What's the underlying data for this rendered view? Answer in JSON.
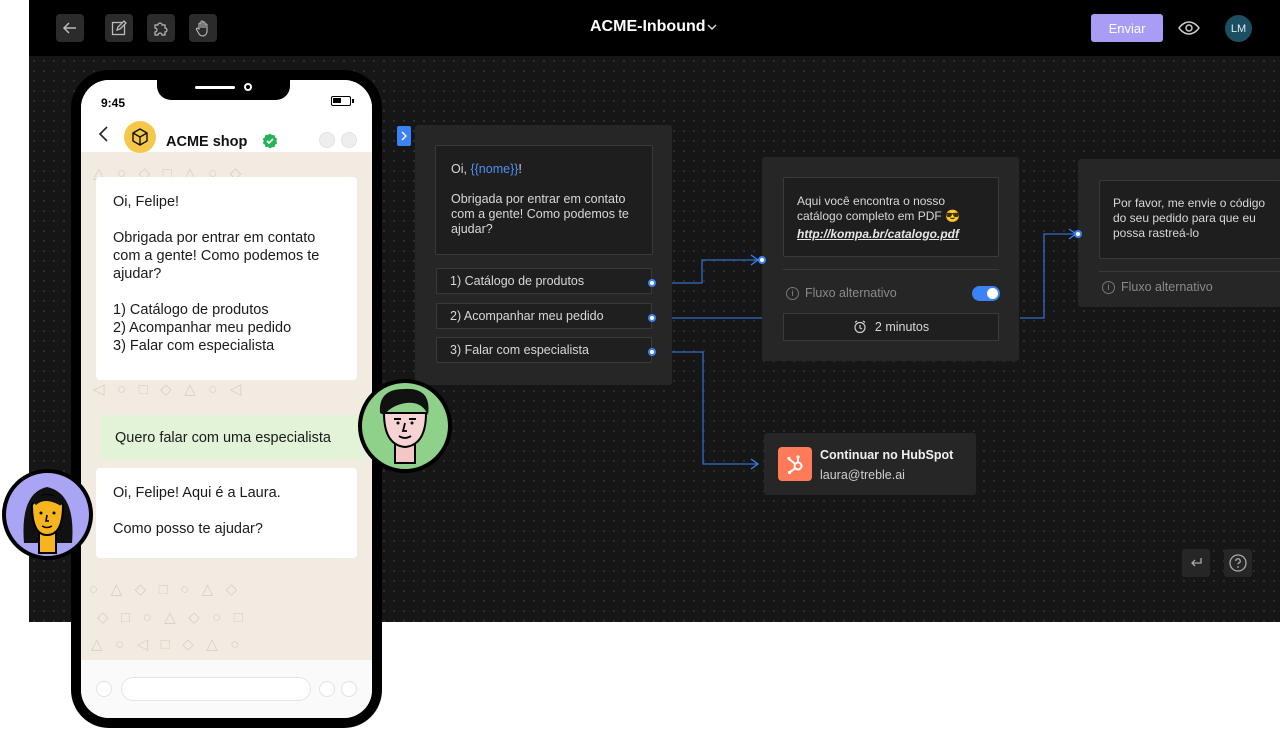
{
  "topbar": {
    "title": "ACME-Inbound",
    "send_label": "Enviar",
    "user_initials": "LM"
  },
  "flow": {
    "welcome_node": {
      "greeting_prefix": "Oi, ",
      "variable": "{{nome}}",
      "greeting_suffix": "!",
      "body": "Obrigada por entrar em contato com a gente! Como podemos te ajudar?",
      "options": [
        "1) Catálogo de produtos",
        "2) Acompanhar meu pedido",
        "3) Falar com especialista"
      ]
    },
    "catalog_node": {
      "text": "Aqui você encontra o nosso catálogo completo em PDF 😎",
      "link": "http://kompa.br/catalogo.pdf",
      "alt_flow_label": "Fluxo alternativo",
      "alt_flow_enabled": true,
      "delay_label": "2 minutos"
    },
    "order_node": {
      "text": "Por favor, me envie o código do seu pedido para que eu possa rastreá-lo",
      "alt_flow_label": "Fluxo alternativo"
    },
    "hubspot_node": {
      "title": "Continuar no HubSpot",
      "email": "laura@treble.ai"
    }
  },
  "phone": {
    "time": "9:45",
    "contact_name": "ACME shop",
    "incoming_1": {
      "greeting": "Oi, Felipe!",
      "body": "Obrigada por entrar em contato com a gente! Como podemos te ajudar?",
      "options": [
        "1) Catálogo de produtos",
        "2) Acompanhar meu pedido",
        "3) Falar com especialista"
      ]
    },
    "outgoing": "Quero falar com uma especialista",
    "incoming_2": {
      "line1": "Oi, Felipe! Aqui é a Laura.",
      "line2": "Como posso te ajudar?"
    }
  },
  "colors": {
    "accent": "#3b82f6",
    "send_button": "#a89cf5",
    "hubspot": "#ff7a59",
    "verified": "#25b35a",
    "outgoing_bubble": "#e3f3d8"
  },
  "icons": [
    "back-arrow-icon",
    "edit-icon",
    "puzzle-icon",
    "hand-icon",
    "chevron-down-icon",
    "eye-icon",
    "info-icon",
    "clock-icon",
    "hubspot-icon",
    "undo-icon",
    "help-icon",
    "box-icon",
    "verified-icon"
  ]
}
